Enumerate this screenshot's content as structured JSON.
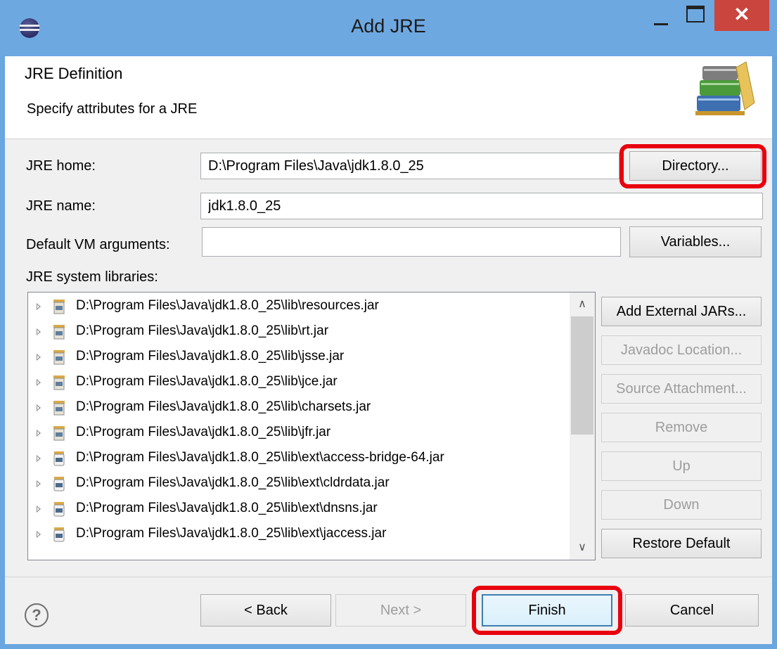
{
  "window": {
    "title": "Add JRE",
    "close_glyph": "✕"
  },
  "header": {
    "title": "JRE Definition",
    "description": "Specify attributes for a JRE",
    "icon": "books-icon"
  },
  "form": {
    "jre_home_label": "JRE home:",
    "jre_home_value": "D:\\Program Files\\Java\\jdk1.8.0_25",
    "directory_button": "Directory...",
    "jre_name_label": "JRE name:",
    "jre_name_value": "jdk1.8.0_25",
    "vm_args_label": "Default VM arguments:",
    "vm_args_value": "",
    "variables_button": "Variables...",
    "libraries_label": "JRE system libraries:"
  },
  "libraries": [
    "D:\\Program Files\\Java\\jdk1.8.0_25\\lib\\resources.jar",
    "D:\\Program Files\\Java\\jdk1.8.0_25\\lib\\rt.jar",
    "D:\\Program Files\\Java\\jdk1.8.0_25\\lib\\jsse.jar",
    "D:\\Program Files\\Java\\jdk1.8.0_25\\lib\\jce.jar",
    "D:\\Program Files\\Java\\jdk1.8.0_25\\lib\\charsets.jar",
    "D:\\Program Files\\Java\\jdk1.8.0_25\\lib\\jfr.jar",
    "D:\\Program Files\\Java\\jdk1.8.0_25\\lib\\ext\\access-bridge-64.jar",
    "D:\\Program Files\\Java\\jdk1.8.0_25\\lib\\ext\\cldrdata.jar",
    "D:\\Program Files\\Java\\jdk1.8.0_25\\lib\\ext\\dnsns.jar",
    "D:\\Program Files\\Java\\jdk1.8.0_25\\lib\\ext\\jaccess.jar"
  ],
  "library_buttons": {
    "add_external": "Add External JARs...",
    "javadoc": "Javadoc Location...",
    "source": "Source Attachment...",
    "remove": "Remove",
    "up": "Up",
    "down": "Down",
    "restore": "Restore Default"
  },
  "footer": {
    "help": "?",
    "back": "< Back",
    "next": "Next >",
    "finish": "Finish",
    "cancel": "Cancel"
  },
  "colors": {
    "titlebar": "#6ea8e1",
    "close": "#c9453d",
    "highlight": "#e8000d"
  }
}
